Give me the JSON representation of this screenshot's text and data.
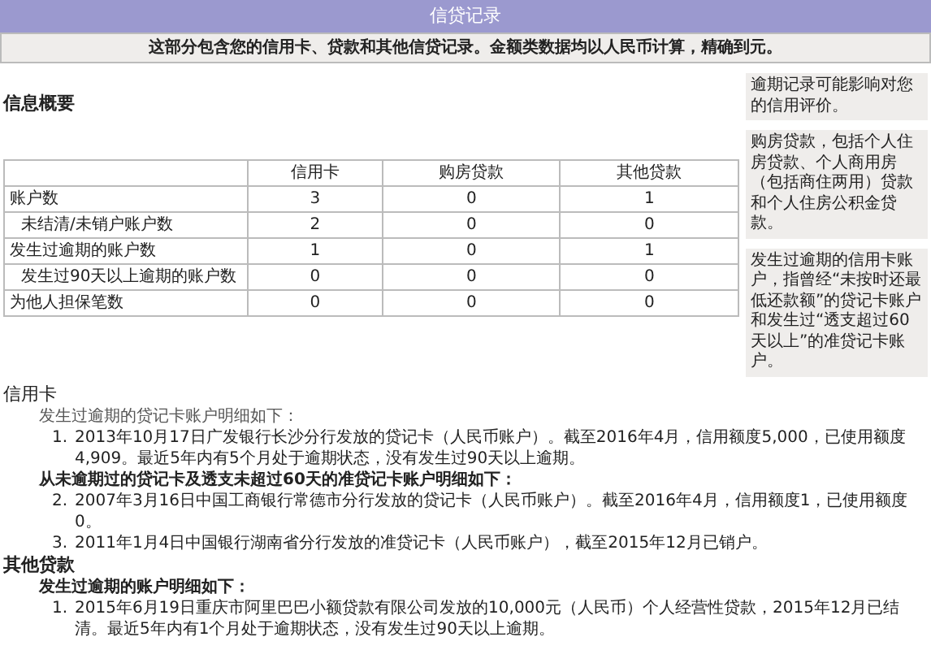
{
  "header": {
    "title": "信贷记录",
    "subtitle": "这部分包含您的信用卡、贷款和其他信贷记录。金额类数据均以人民币计算，精确到元。"
  },
  "overview": {
    "title": "信息概要",
    "table": {
      "columns": [
        "信用卡",
        "购房贷款",
        "其他贷款"
      ],
      "rows": [
        {
          "label": "账户数",
          "indented": false,
          "values": [
            "3",
            "0",
            "1"
          ]
        },
        {
          "label": "未结清/未销户账户数",
          "indented": true,
          "values": [
            "2",
            "0",
            "0"
          ]
        },
        {
          "label": "发生过逾期的账户数",
          "indented": false,
          "values": [
            "1",
            "0",
            "1"
          ]
        },
        {
          "label": "发生过90天以上逾期的账户数",
          "indented": true,
          "values": [
            "0",
            "0",
            "0"
          ]
        },
        {
          "label": "为他人担保笔数",
          "indented": false,
          "values": [
            "0",
            "0",
            "0"
          ]
        }
      ]
    },
    "notes": [
      "逾期记录可能影响对您的信用评价。",
      "购房贷款，包括个人住房贷款、个人商用房（包括商住两用）贷款和个人住房公积金贷款。",
      "发生过逾期的信用卡账户，指曾经“未按时还最低还款额”的贷记卡账户和发生过“透支超过60天以上”的准贷记卡账户。"
    ]
  },
  "sections": [
    {
      "title": "信用卡",
      "groups": [
        {
          "heading": "发生过逾期的贷记卡账户明细如下：",
          "bold": false,
          "items": [
            {
              "number": "1.",
              "text": "2013年10月17日广发银行长沙分行发放的贷记卡（人民币账户）。截至2016年4月，信用额度5,000，已使用额度4,909。最近5年内有5个月处于逾期状态，没有发生过90天以上逾期。"
            }
          ]
        },
        {
          "heading": "从未逾期过的贷记卡及透支未超过60天的准贷记卡账户明细如下：",
          "bold": true,
          "items": [
            {
              "number": "2.",
              "text": "2007年3月16日中国工商银行常德市分行发放的贷记卡（人民币账户）。截至2016年4月，信用额度1，已使用额度0。"
            },
            {
              "number": "3.",
              "text": "2011年1月4日中国银行湖南省分行发放的准贷记卡（人民币账户），截至2015年12月已销户。"
            }
          ]
        }
      ]
    },
    {
      "title": "其他贷款",
      "groups": [
        {
          "heading": "发生过逾期的账户明细如下：",
          "bold": true,
          "items": [
            {
              "number": "1.",
              "text": "2015年6月19日重庆市阿里巴巴小额贷款有限公司发放的10,000元（人民币）个人经营性贷款，2015年12月已结清。最近5年内有1个月处于逾期状态，没有发生过90天以上逾期。"
            }
          ]
        }
      ]
    }
  ]
}
